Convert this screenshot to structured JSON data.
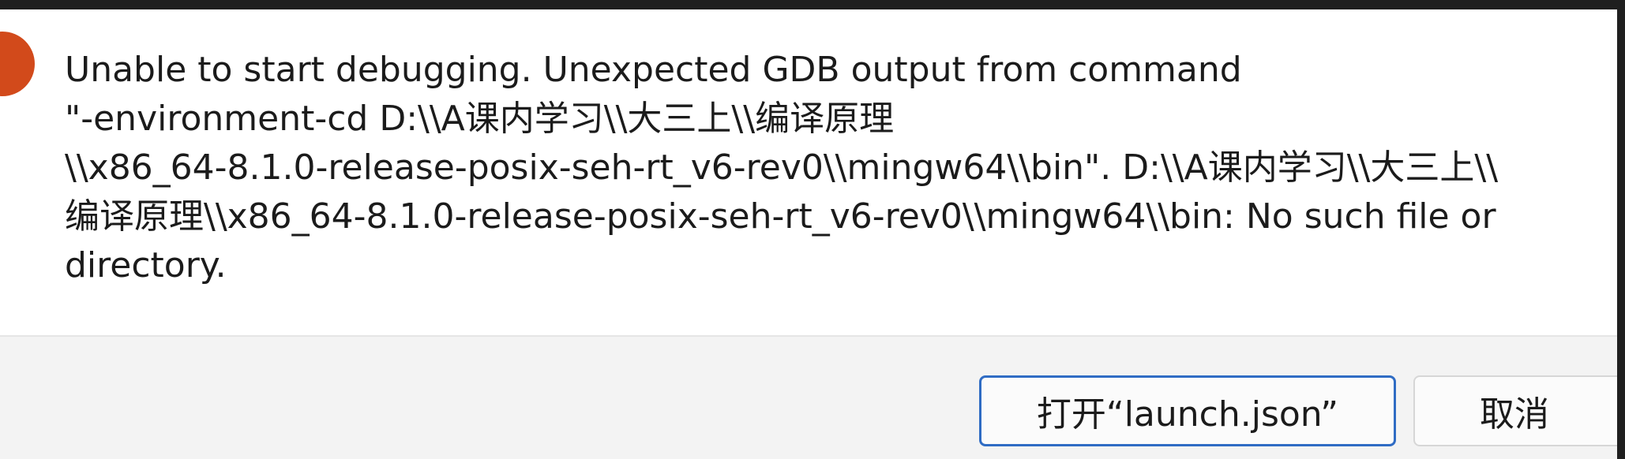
{
  "dialog": {
    "message": "Unable to start debugging. Unexpected GDB output from command\n\"-environment-cd D:\\\\A课内学习\\\\大三上\\\\编译原理\n\\\\x86_64-8.1.0-release-posix-seh-rt_v6-rev0\\\\mingw64\\\\bin\". D:\\\\A课内学习\\\\大三上\\\\\n编译原理\\\\x86_64-8.1.0-release-posix-seh-rt_v6-rev0\\\\mingw64\\\\bin: No such file or\ndirectory.",
    "icon": "error-icon",
    "buttons": {
      "open_launch_json": "打开“launch.json”",
      "cancel": "取消"
    }
  },
  "colors": {
    "error": "#d24a1b",
    "primary_border": "#2f6cc4",
    "footer_bg": "#f3f3f3"
  }
}
